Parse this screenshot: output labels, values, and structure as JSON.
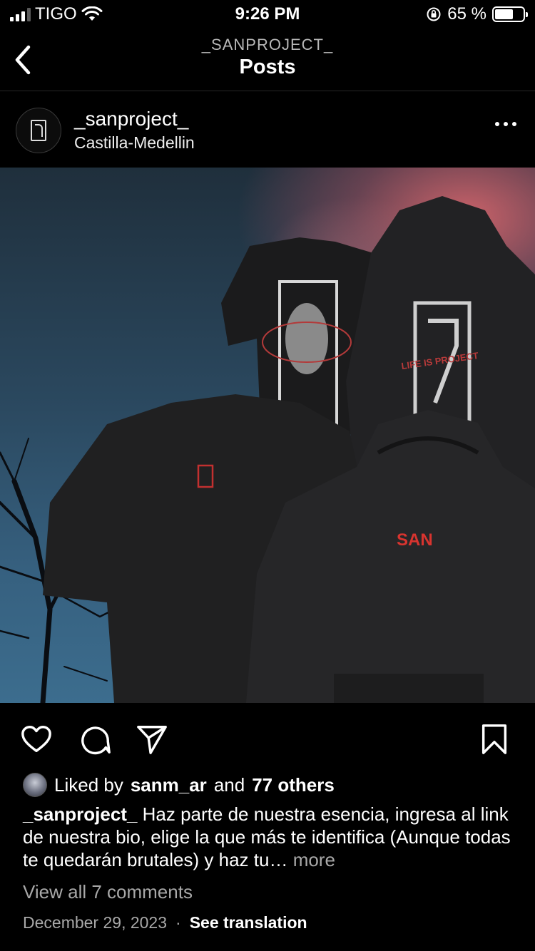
{
  "status_bar": {
    "carrier": "TIGO",
    "time": "9:26 PM",
    "battery": "65 %",
    "battery_level": 0.65
  },
  "header": {
    "account": "_SANPROJECT_",
    "title": "Posts"
  },
  "post": {
    "username": "_sanproject_",
    "location": "Castilla-Medellin",
    "image_text": {
      "tee_logo": "SAN",
      "hoodie_logo": "SAN",
      "back_print": "LIFE IS PROJECT"
    }
  },
  "actions": {
    "like": "heart-icon",
    "comment": "comment-icon",
    "share": "send-icon",
    "save": "bookmark-icon"
  },
  "likes": {
    "prefix": "Liked by",
    "user": "sanm_ar",
    "middle": "and",
    "others": "77 others"
  },
  "caption": {
    "username": "_sanproject_",
    "text": "Haz parte de nuestra esencia, ingresa al link de nuestra bio, elige la que más te identifica (Aunque todas te quedarán brutales) y haz tu…",
    "more": "more"
  },
  "comments": {
    "view_all": "View all 7 comments"
  },
  "meta": {
    "date": "December 29, 2023",
    "separator": "·",
    "translate": "See translation"
  }
}
